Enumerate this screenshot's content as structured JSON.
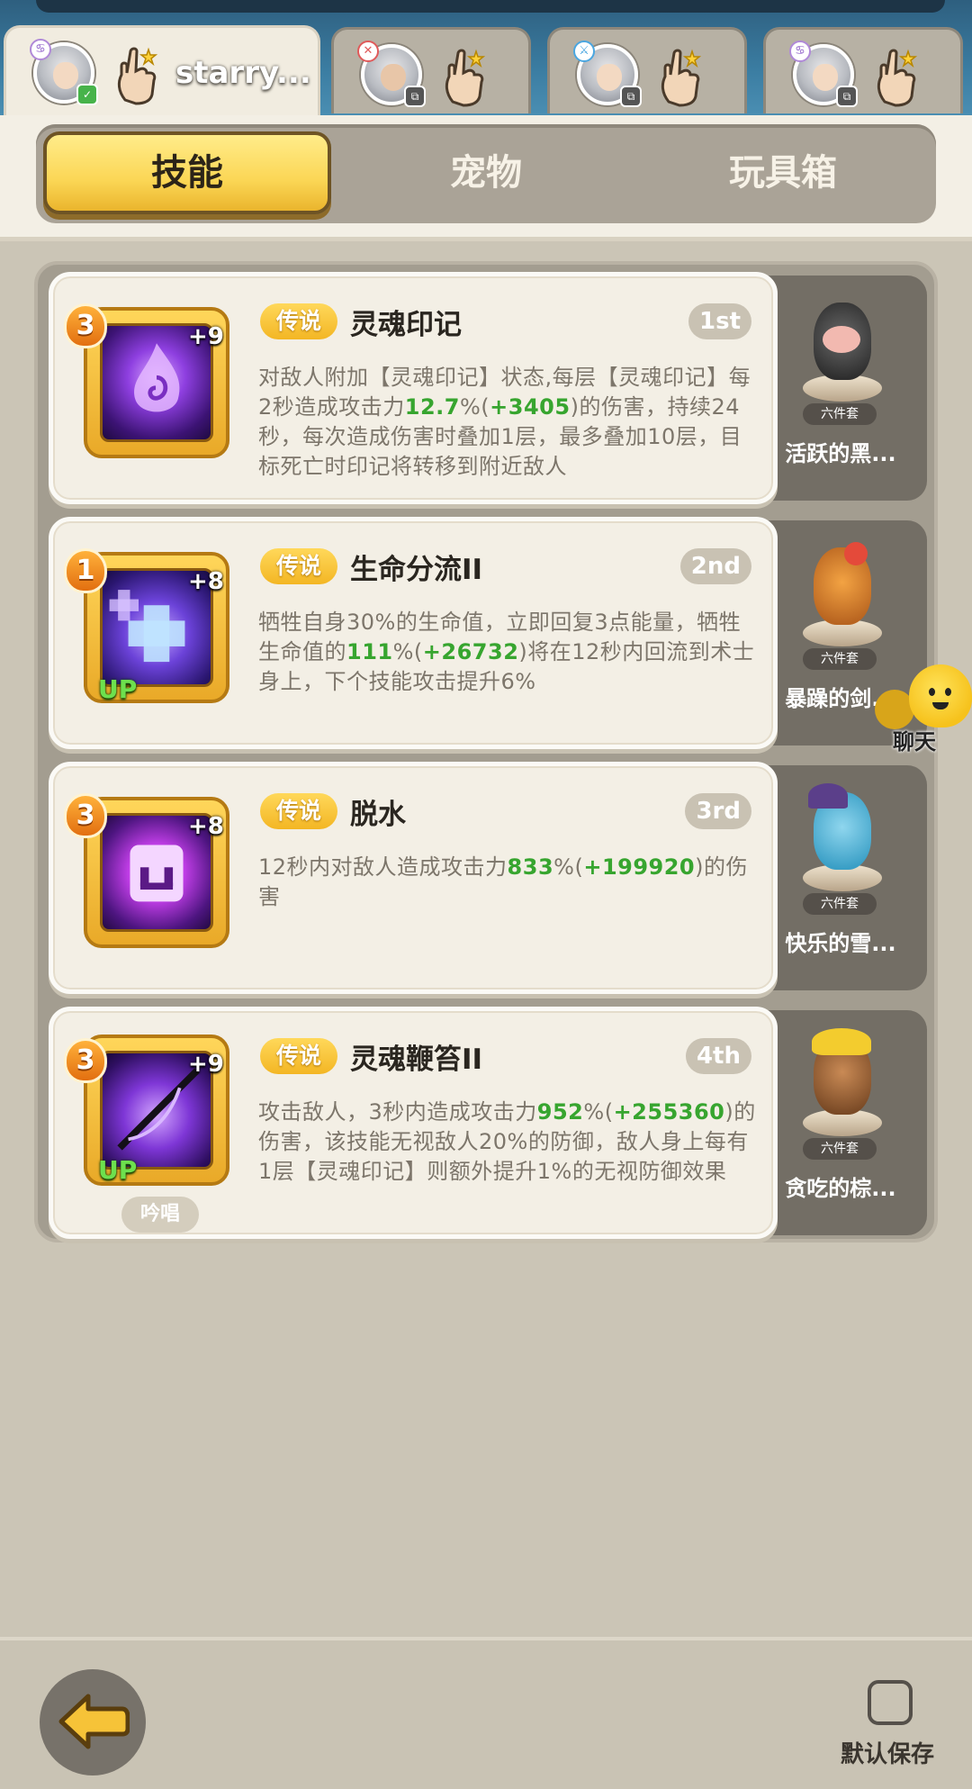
{
  "players": [
    {
      "name": "starry...",
      "active": true
    },
    {
      "name": "",
      "active": false
    },
    {
      "name": "",
      "active": false
    },
    {
      "name": "",
      "active": false
    }
  ],
  "categories": [
    "技能",
    "宠物",
    "玩具箱"
  ],
  "skills": [
    {
      "level": "3",
      "plus": "+9",
      "up": "",
      "rarity": "传说",
      "name": "灵魂印记",
      "rank": "1st",
      "desc": [
        "对敌人附加【灵魂印记】状态,每层【灵魂印记】每2秒造成攻击力",
        "12.7",
        "%(",
        "+3405",
        ")的伤害，持续24秒，每次造成伤害时叠加1层，最多叠加10层，目标死亡时印记将转移到附近敌人"
      ],
      "suit_tag": "六件套",
      "suit_name": "活跃的黑..."
    },
    {
      "level": "1",
      "plus": "+8",
      "up": "UP",
      "rarity": "传说",
      "name": "生命分流II",
      "rank": "2nd",
      "desc": [
        "牺牲自身30%的生命值，立即回复3点能量，牺牲生命值的",
        "111",
        "%(",
        "+26732",
        ")将在12秒内回流到术士身上，下个技能攻击提升6%"
      ],
      "suit_tag": "六件套",
      "suit_name": "暴躁的剑..."
    },
    {
      "level": "3",
      "plus": "+8",
      "up": "",
      "rarity": "传说",
      "name": "脱水",
      "rank": "3rd",
      "desc": [
        "12秒内对敌人造成攻击力",
        "833",
        "%(",
        "+199920",
        ")的伤害"
      ],
      "suit_tag": "六件套",
      "suit_name": "快乐的雪..."
    },
    {
      "level": "3",
      "plus": "+9",
      "up": "UP",
      "rarity": "传说",
      "name": "灵魂鞭笞II",
      "rank": "4th",
      "desc": [
        "攻击敌人，3秒内造成攻击力",
        "952",
        "%(",
        "+255360",
        ")的伤害，该技能无视敌人20%的防御，敌人身上每有1层【灵魂印记】则额外提升1%的无视防御效果"
      ],
      "chant": "吟唱",
      "suit_tag": "六件套",
      "suit_name": "贪吃的棕..."
    }
  ],
  "chat_label": "聊天",
  "save_label": "默认保存",
  "colors": {
    "accent": "#fbd655",
    "highlight": "#37a52f",
    "panel": "#f3efe5"
  }
}
